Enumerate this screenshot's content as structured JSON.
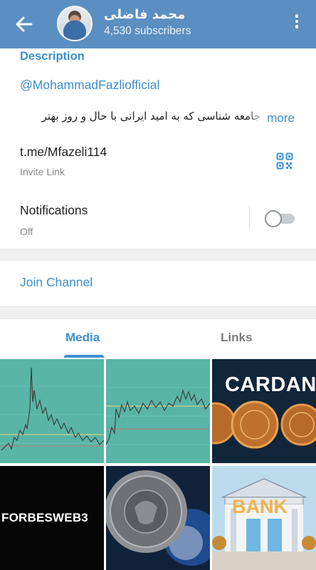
{
  "header": {
    "channel_name": "محمد فاضلی",
    "subscribers": "4,530 subscribers",
    "back_icon": "arrow-left-icon",
    "menu_icon": "more-vertical-icon",
    "color": "#5b8fc1"
  },
  "info": {
    "description_label": "Description",
    "handle": "@MohammadFazliofficial",
    "description_text": "جامعه شناسی که به امید ایرانی با حال و روز بهتر",
    "more_label": "more",
    "link": "t.me/Mfazeli114",
    "link_sub": "Invite Link",
    "qr_icon": "qr-code-icon",
    "notifications_label": "Notifications",
    "notifications_state": "Off",
    "notifications_on": false
  },
  "actions": {
    "join_label": "Join Channel"
  },
  "tabs": [
    {
      "label": "Media",
      "active": true
    },
    {
      "label": "Links",
      "active": false
    }
  ],
  "media": {
    "cardano_label": "CARDAN",
    "forbes_label": "FORBESWEB3",
    "bank_label": "BANK"
  },
  "colors": {
    "accent": "#3d8fd0",
    "chart_bg": "#59b5a6"
  }
}
